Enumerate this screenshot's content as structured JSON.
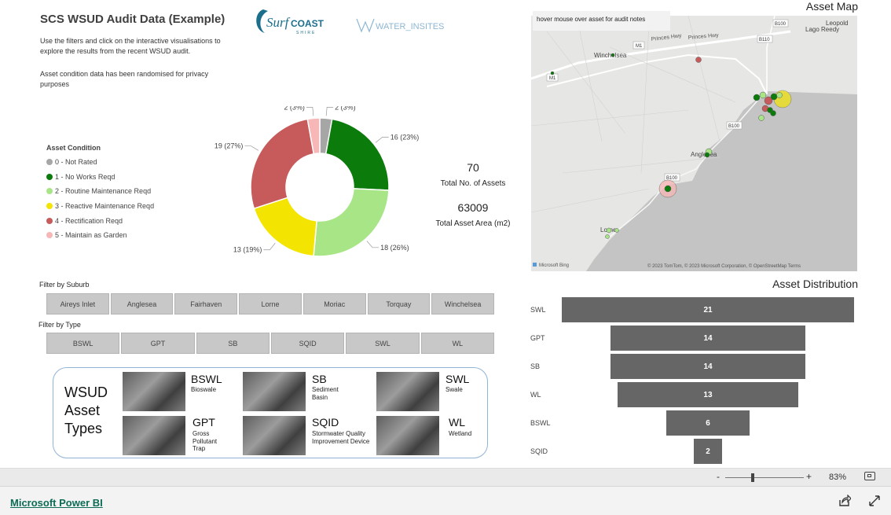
{
  "header": {
    "title": "SCS WSUD Audit Data (Example)",
    "intro": "Use the filters and click on the interactive visualisations to explore the results from the recent WSUD audit.",
    "intro2": "Asset condition data has been randomised for privacy purposes",
    "logo_surf_text": "Surf",
    "logo_coast_text": "COAST",
    "logo_shire_text": "SHIRE",
    "logo_water_text": "WATER_INSITES"
  },
  "legend": {
    "title": "Asset Condition",
    "items": [
      {
        "label": "0 - Not Rated",
        "color": "#a6a6a6"
      },
      {
        "label": "1 - No Works Reqd",
        "color": "#0b7b0b"
      },
      {
        "label": "2 - Routine Maintenance Reqd",
        "color": "#a8e587"
      },
      {
        "label": "3 - Reactive Maintenance Reqd",
        "color": "#f3e402"
      },
      {
        "label": "4 - Rectification Reqd",
        "color": "#c75b5b"
      },
      {
        "label": "5 - Maintain as Garden",
        "color": "#f7b7b7"
      }
    ]
  },
  "chart_data": {
    "type": "pie",
    "variant": "donut",
    "categories": [
      "0 - Not Rated",
      "1 - No Works Reqd",
      "2 - Routine Maintenance Reqd",
      "3 - Reactive Maintenance Reqd",
      "4 - Rectification Reqd",
      "5 - Maintain as Garden"
    ],
    "values": [
      2,
      16,
      18,
      13,
      19,
      2
    ],
    "labels": [
      "2 (3%)",
      "16 (23%)",
      "18 (26%)",
      "13 (19%)",
      "19 (27%)",
      "2 (3%)"
    ],
    "colors": [
      "#a6a6a6",
      "#0b7b0b",
      "#a8e587",
      "#f3e402",
      "#c75b5b",
      "#f7b7b7"
    ]
  },
  "kpis": {
    "assets_value": "70",
    "assets_label": "Total No. of Assets",
    "area_value": "63009",
    "area_label": "Total Asset Area (m2)"
  },
  "filters": {
    "suburb_label": "Filter by Suburb",
    "suburbs": [
      "Aireys Inlet",
      "Anglesea",
      "Fairhaven",
      "Lorne",
      "Moriac",
      "Torquay",
      "Winchelsea"
    ],
    "type_label": "Filter by Type",
    "types": [
      "BSWL",
      "GPT",
      "SB",
      "SQID",
      "SWL",
      "WL"
    ]
  },
  "asset_types": {
    "title_line1": "WSUD",
    "title_line2": "Asset",
    "title_line3": "Types",
    "items": [
      {
        "code": "BSWL",
        "desc": "Bioswale"
      },
      {
        "code": "SB",
        "desc": "Sediment Basin"
      },
      {
        "code": "SWL",
        "desc": "Swale"
      },
      {
        "code": "GPT",
        "desc": "Gross Pollutant Trap"
      },
      {
        "code": "SQID",
        "desc": "Stormwater Quality Improvement Device"
      },
      {
        "code": "WL",
        "desc": "Wetland"
      }
    ]
  },
  "map": {
    "title": "Asset Map",
    "note": "hover mouse over asset for audit notes",
    "places": [
      "Winchelsea",
      "Anglesea",
      "Lorne",
      "Leopold",
      "Lago Reedy"
    ],
    "roads": [
      "Princes Hwy",
      "Princes Hwy",
      "M1",
      "M1",
      "B100",
      "B110",
      "B100",
      "B100"
    ],
    "bing_label": "Microsoft Bing",
    "attribution": "© 2023 TomTom, © 2023 Microsoft Corporation, © OpenStreetMap  Terms"
  },
  "distribution": {
    "title": "Asset Distribution",
    "rows": [
      {
        "label": "SWL",
        "value": 21
      },
      {
        "label": "GPT",
        "value": 14
      },
      {
        "label": "SB",
        "value": 14
      },
      {
        "label": "WL",
        "value": 13
      },
      {
        "label": "BSWL",
        "value": 6
      },
      {
        "label": "SQID",
        "value": 2
      }
    ]
  },
  "zoom": {
    "minus": "-",
    "plus": "+",
    "level": "83%",
    "level_fraction": 0.83
  },
  "footer": {
    "link": "Microsoft Power BI"
  }
}
